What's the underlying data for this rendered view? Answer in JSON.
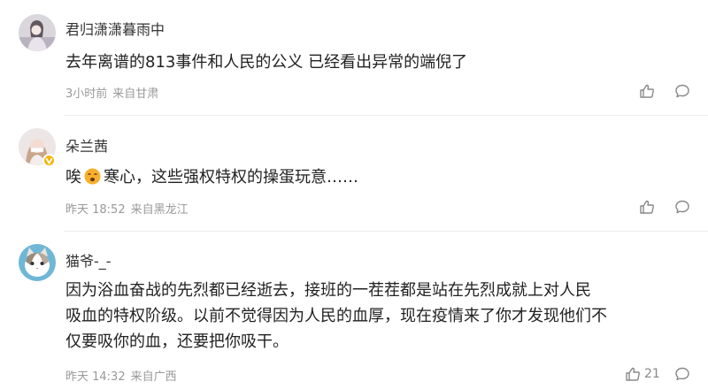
{
  "comments": [
    {
      "username": "君归潇潇暮雨中",
      "text_lines": [
        "去年离谱的813事件和人民的公义 已经看出异常的端倪了"
      ],
      "time": "3小时前",
      "location": "来自甘肃",
      "like_count": ""
    },
    {
      "username": "朵兰茜",
      "text_before_emoji": "唉",
      "emoji": "face-icon",
      "text_after_emoji": "寒心，这些强权特权的操蛋玩意……",
      "time": "昨天 18:52",
      "location": "来自黑龙江",
      "like_count": "",
      "verified_badge": true
    },
    {
      "username": "猫爷-_-",
      "text_lines": [
        "因为浴血奋战的先烈都已经逝去，接班的一茬茬都是站在先烈成就上对人民",
        "吸血的特权阶级。以前不觉得因为人民的血厚，现在疫情来了你才发现他们不",
        "仅要吸你的血，还要把你吸干。"
      ],
      "time": "昨天 14:32",
      "location": "来自广西",
      "like_count": "21"
    }
  ],
  "icons": {
    "like": "thumbs-up-icon",
    "reply": "comment-bubble-icon"
  },
  "colors": {
    "badge": "#f7b500",
    "meta": "#999999",
    "divider": "#ececec"
  }
}
